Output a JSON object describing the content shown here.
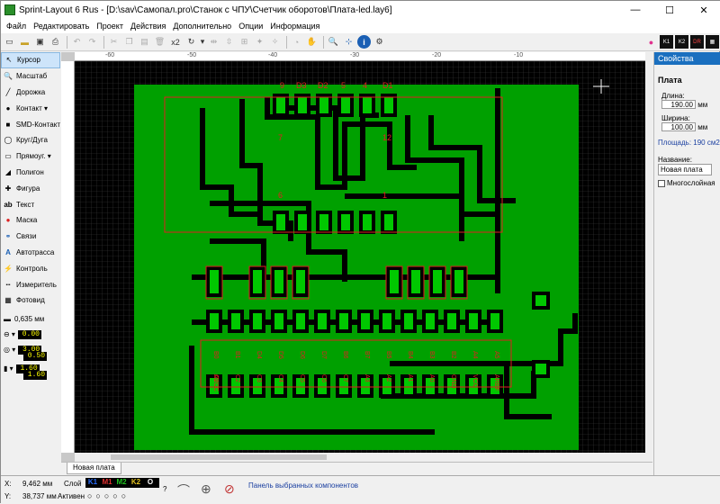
{
  "window": {
    "title": "Sprint-Layout 6 Rus - [D:\\sav\\Самопал.pro\\Станок с ЧПУ\\Счетчик оборотов\\Плата-led.lay6]"
  },
  "menu": [
    "Файл",
    "Редактировать",
    "Проект",
    "Действия",
    "Дополнительно",
    "Опции",
    "Информация"
  ],
  "toolbar": {
    "multiplier": "x2"
  },
  "tools": [
    "Курсор",
    "Масштаб",
    "Дорожка",
    "Контакт",
    "SMD-Контакт",
    "Круг/Дуга",
    "Прямоуг.",
    "Полигон",
    "Фигура",
    "Текст",
    "Маска",
    "Связи",
    "Автотрасса",
    "Контроль",
    "Измеритель",
    "Фотовид"
  ],
  "params": {
    "track_width": "0,635 мм",
    "v1": "0.00",
    "v2": "3.00",
    "v3": "0.50",
    "v4": "1.60",
    "v5": "1.60"
  },
  "ruler": {
    "top": [
      "-60",
      "-50",
      "-40",
      "-30",
      "-20",
      "-10"
    ]
  },
  "board": {
    "silk_top": [
      "9",
      "D3",
      "D2",
      "5",
      "4",
      "D1"
    ],
    "silk_mid": [
      "7",
      "12"
    ],
    "silk_low": [
      "6",
      "1"
    ],
    "bottom_labels": [
      "B0",
      "B1",
      "D4",
      "D5",
      "D6",
      "D7",
      "B6",
      "B7",
      "B5",
      "B4",
      "B3",
      "B2",
      "A4",
      "A5",
      "C1",
      "C2",
      "C3",
      "C4",
      "C5",
      "C6",
      "C7",
      "A3",
      "A2",
      "A1",
      "A0",
      "GND",
      "VCC",
      "AREF",
      "AVCC"
    ]
  },
  "tabs": [
    "Новая плата"
  ],
  "properties": {
    "header": "Свойства",
    "section": "Плата",
    "length_label": "Длина:",
    "length": "190.00",
    "width_label": "Ширина:",
    "width": "100.00",
    "unit": "мм",
    "area": "Площадь: 190 см2",
    "name_label": "Название:",
    "name": "Новая плата",
    "multilayer": "Многослойная"
  },
  "status": {
    "x_label": "X:",
    "x": "9,462 мм",
    "y_label": "Y:",
    "y": "38,737 мм",
    "layer_label": "Слой",
    "active_label": "Активен",
    "layers": [
      "K1",
      "M1",
      "M2",
      "K2",
      "O"
    ],
    "message": "Панель выбранных компонентов"
  }
}
